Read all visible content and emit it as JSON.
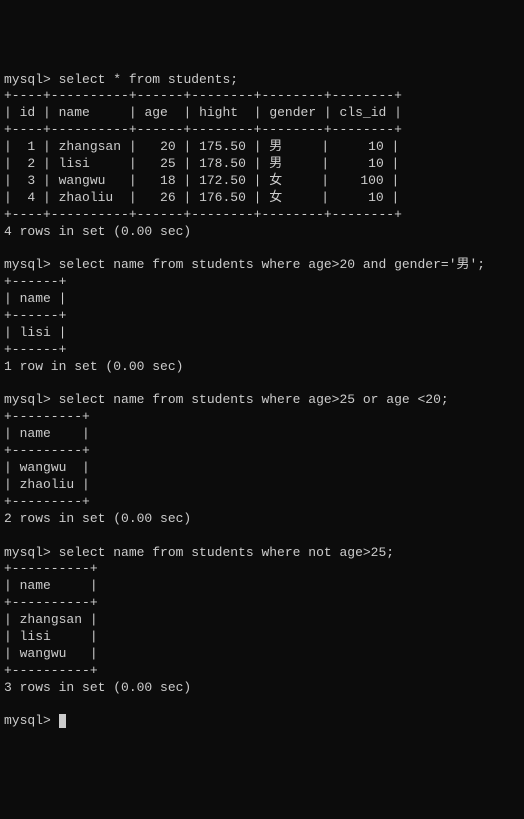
{
  "prompt": "mysql>",
  "query1": {
    "sql": "select * from students;",
    "headers": {
      "id": "id",
      "name": "name",
      "age": "age",
      "hight": "hight",
      "gender": "gender",
      "cls_id": "cls_id"
    },
    "rows": [
      {
        "id": "1",
        "name": "zhangsan",
        "age": "20",
        "hight": "175.50",
        "gender": "男",
        "cls_id": "10"
      },
      {
        "id": "2",
        "name": "lisi",
        "age": "25",
        "hight": "178.50",
        "gender": "男",
        "cls_id": "10"
      },
      {
        "id": "3",
        "name": "wangwu",
        "age": "18",
        "hight": "172.50",
        "gender": "女",
        "cls_id": "100"
      },
      {
        "id": "4",
        "name": "zhaoliu",
        "age": "26",
        "hight": "176.50",
        "gender": "女",
        "cls_id": "10"
      }
    ],
    "status": "4 rows in set (0.00 sec)"
  },
  "query2": {
    "sql": "select name from students where age>20 and gender='男';",
    "header": "name",
    "rows": [
      "lisi"
    ],
    "status": "1 row in set (0.00 sec)"
  },
  "query3": {
    "sql": "select name from students where age>25 or age <20;",
    "header": "name",
    "rows": [
      "wangwu",
      "zhaoliu"
    ],
    "status": "2 rows in set (0.00 sec)"
  },
  "query4": {
    "sql": "select name from students where not age>25;",
    "header": "name",
    "rows": [
      "zhangsan",
      "lisi",
      "wangwu"
    ],
    "status": "3 rows in set (0.00 sec)"
  },
  "chart_data": {
    "type": "table",
    "title": "students",
    "columns": [
      "id",
      "name",
      "age",
      "hight",
      "gender",
      "cls_id"
    ],
    "data": [
      [
        1,
        "zhangsan",
        20,
        175.5,
        "男",
        10
      ],
      [
        2,
        "lisi",
        25,
        178.5,
        "男",
        10
      ],
      [
        3,
        "wangwu",
        18,
        172.5,
        "女",
        100
      ],
      [
        4,
        "zhaoliu",
        26,
        176.5,
        "女",
        10
      ]
    ]
  },
  "separators": {
    "q1": "+----+----------+------+--------+--------+--------+",
    "q2": "+------+",
    "q3": "+---------+",
    "q4": "+----------+"
  }
}
